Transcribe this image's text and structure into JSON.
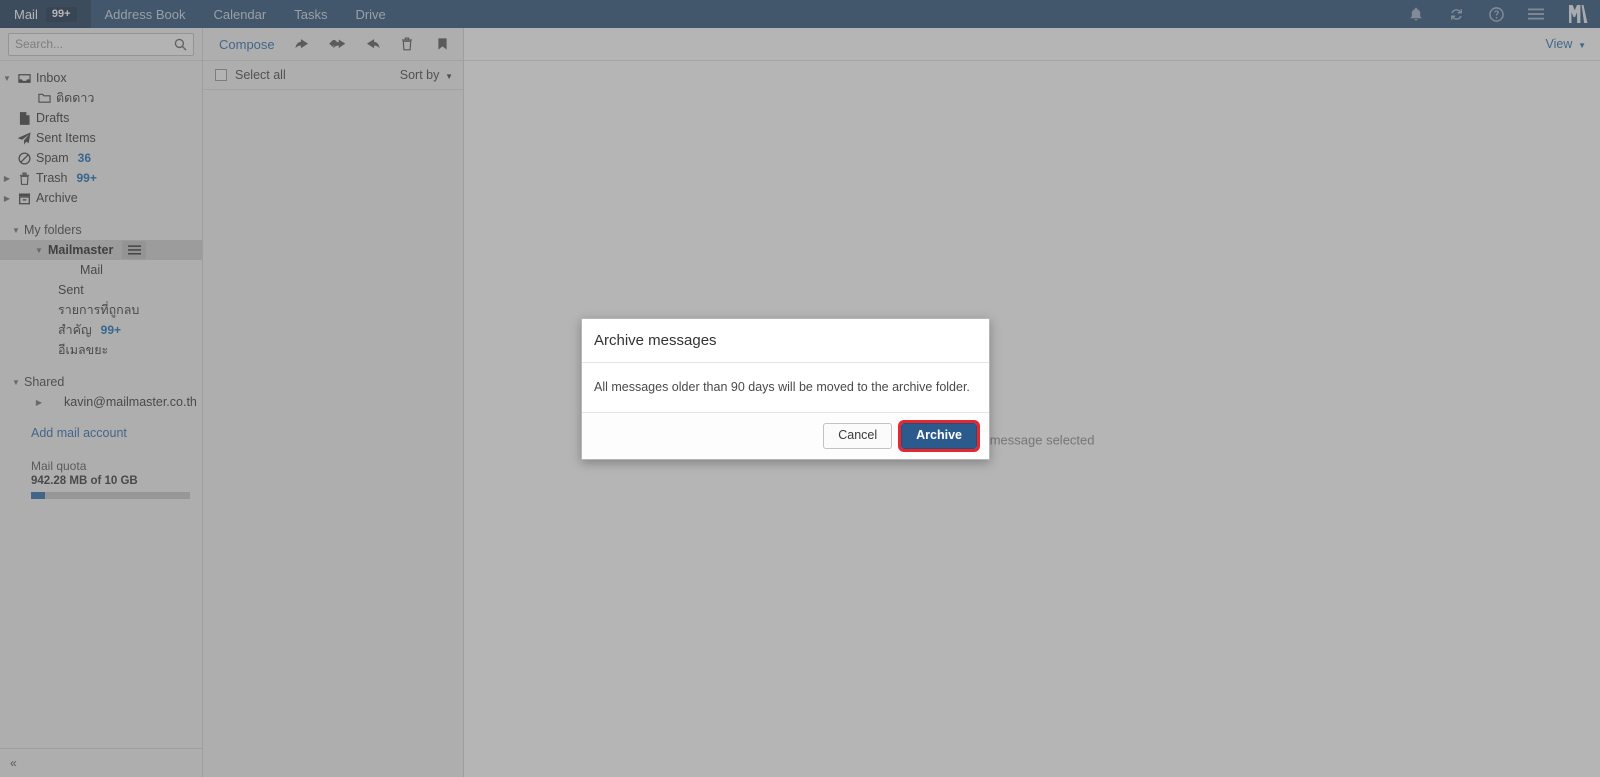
{
  "topbar": {
    "tabs": [
      {
        "label": "Mail",
        "badge": "99+",
        "active": true,
        "name": "nav-tab-mail"
      },
      {
        "label": "Address Book",
        "badge": "",
        "active": false,
        "name": "nav-tab-address-book"
      },
      {
        "label": "Calendar",
        "badge": "",
        "active": false,
        "name": "nav-tab-calendar"
      },
      {
        "label": "Tasks",
        "badge": "",
        "active": false,
        "name": "nav-tab-tasks"
      },
      {
        "label": "Drive",
        "badge": "",
        "active": false,
        "name": "nav-tab-drive"
      }
    ],
    "icons": [
      "notifications-bell-icon",
      "refresh-icon",
      "help-icon",
      "app-menu-icon"
    ],
    "logo": "M"
  },
  "sidebar": {
    "search": {
      "placeholder": "Search...",
      "value": "",
      "icon": "search-icon"
    },
    "system_folders": [
      {
        "label": "Inbox",
        "icon": "inbox-icon",
        "count": "",
        "twisty": "down",
        "indent": 0
      },
      {
        "label": "ติดดาว",
        "icon": "folder-icon",
        "count": "",
        "twisty": "",
        "indent": 1
      },
      {
        "label": "Drafts",
        "icon": "drafts-icon",
        "count": "",
        "twisty": "",
        "indent": 0
      },
      {
        "label": "Sent Items",
        "icon": "sent-icon",
        "count": "",
        "twisty": "",
        "indent": 0
      },
      {
        "label": "Spam",
        "icon": "spam-icon",
        "count": "36",
        "twisty": "",
        "indent": 0
      },
      {
        "label": "Trash",
        "icon": "trash-icon",
        "count": "99+",
        "twisty": "right",
        "indent": 0
      },
      {
        "label": "Archive",
        "icon": "archive-icon",
        "count": "",
        "twisty": "right",
        "indent": 0
      }
    ],
    "my_folders_label": "My folders",
    "account": {
      "label": "Mailmaster",
      "selected": true,
      "menu_icon": "hamburger-menu-icon"
    },
    "account_folders": [
      {
        "label": "Mail",
        "count": ""
      },
      {
        "label": "Sent",
        "count": ""
      },
      {
        "label": "รายการที่ถูกลบ",
        "count": ""
      },
      {
        "label": "สำคัญ",
        "count": "99+"
      },
      {
        "label": "อีเมลขยะ",
        "count": ""
      }
    ],
    "shared_label": "Shared",
    "shared_items": [
      {
        "label": "kavin@mailmaster.co.th",
        "twisty": "right"
      }
    ],
    "add_account_label": "Add mail account",
    "quota": {
      "title": "Mail quota",
      "value": "942.28 MB of 10 GB",
      "percent": 9,
      "fill_color": "#2f6fb0"
    },
    "collapse_label": "«"
  },
  "message_list": {
    "compose_label": "Compose",
    "toolbar_icons": [
      "reply-icon",
      "reply-all-icon",
      "forward-icon",
      "delete-icon",
      "flag-icon"
    ],
    "select_all_label": "Select all",
    "sort_by_label": "Sort by",
    "items": []
  },
  "reading_pane": {
    "view_label": "View",
    "empty_message": "No message selected"
  },
  "dialog": {
    "title": "Archive messages",
    "body": "All messages older than 90 days will be moved to the archive folder.",
    "cancel_label": "Cancel",
    "confirm_label": "Archive",
    "confirm_color": "#2b5a8c",
    "highlight_color": "#e8262d"
  }
}
